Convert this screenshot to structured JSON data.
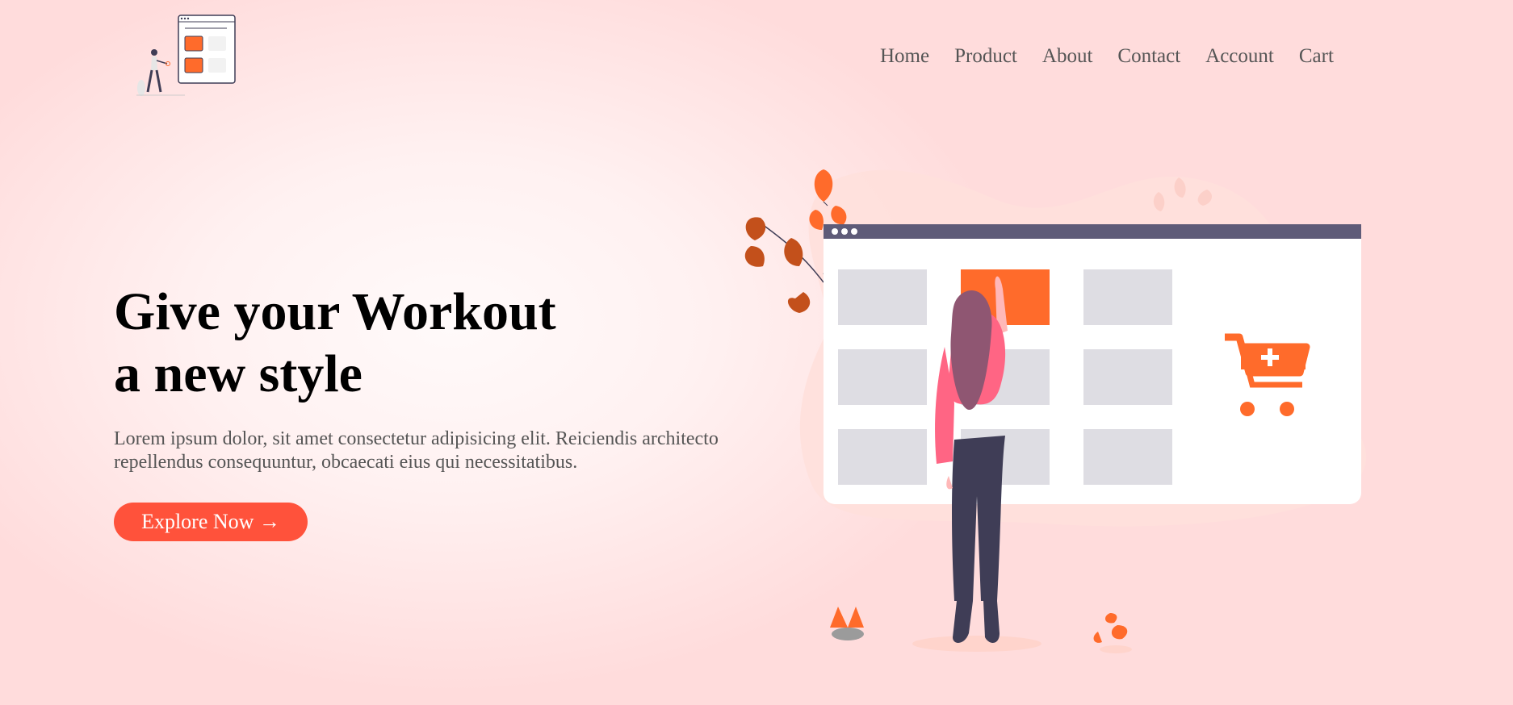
{
  "nav": {
    "items": [
      {
        "label": "Home"
      },
      {
        "label": "Product"
      },
      {
        "label": "About"
      },
      {
        "label": "Contact"
      },
      {
        "label": "Account"
      },
      {
        "label": "Cart"
      }
    ]
  },
  "hero": {
    "title_line1": "Give your Workout",
    "title_line2": "a new style",
    "description": "Lorem ipsum dolor, sit amet consectetur adipisicing elit. Reiciendis architecto repellendus consequuntur, obcaecati eius qui necessitatibus.",
    "cta_label": "Explore Now →"
  },
  "colors": {
    "accent": "#ff523b",
    "illustration_orange": "#ff6b2b",
    "browser_bar": "#5e5b78"
  },
  "icons": [
    "logo-illustration",
    "shopping-cart-plus-icon",
    "leaf-decoration"
  ]
}
